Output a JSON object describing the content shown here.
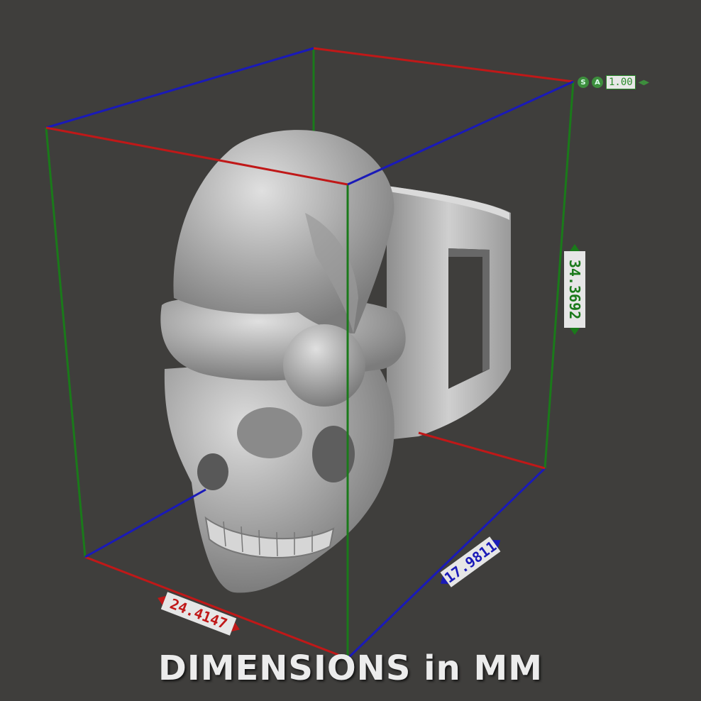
{
  "caption": "DIMENSIONS in MM",
  "dimensions": {
    "width": "24.4147",
    "depth": "17.9811",
    "height": "34.3692"
  },
  "gizmo": {
    "s_label": "S",
    "a_label": "A",
    "value": "1.00"
  },
  "colors": {
    "background": "#3f3e3c",
    "x_axis": "#c01818",
    "y_axis": "#1a7a1a",
    "z_axis": "#1a1ab8",
    "model": "#b8b8b8"
  }
}
